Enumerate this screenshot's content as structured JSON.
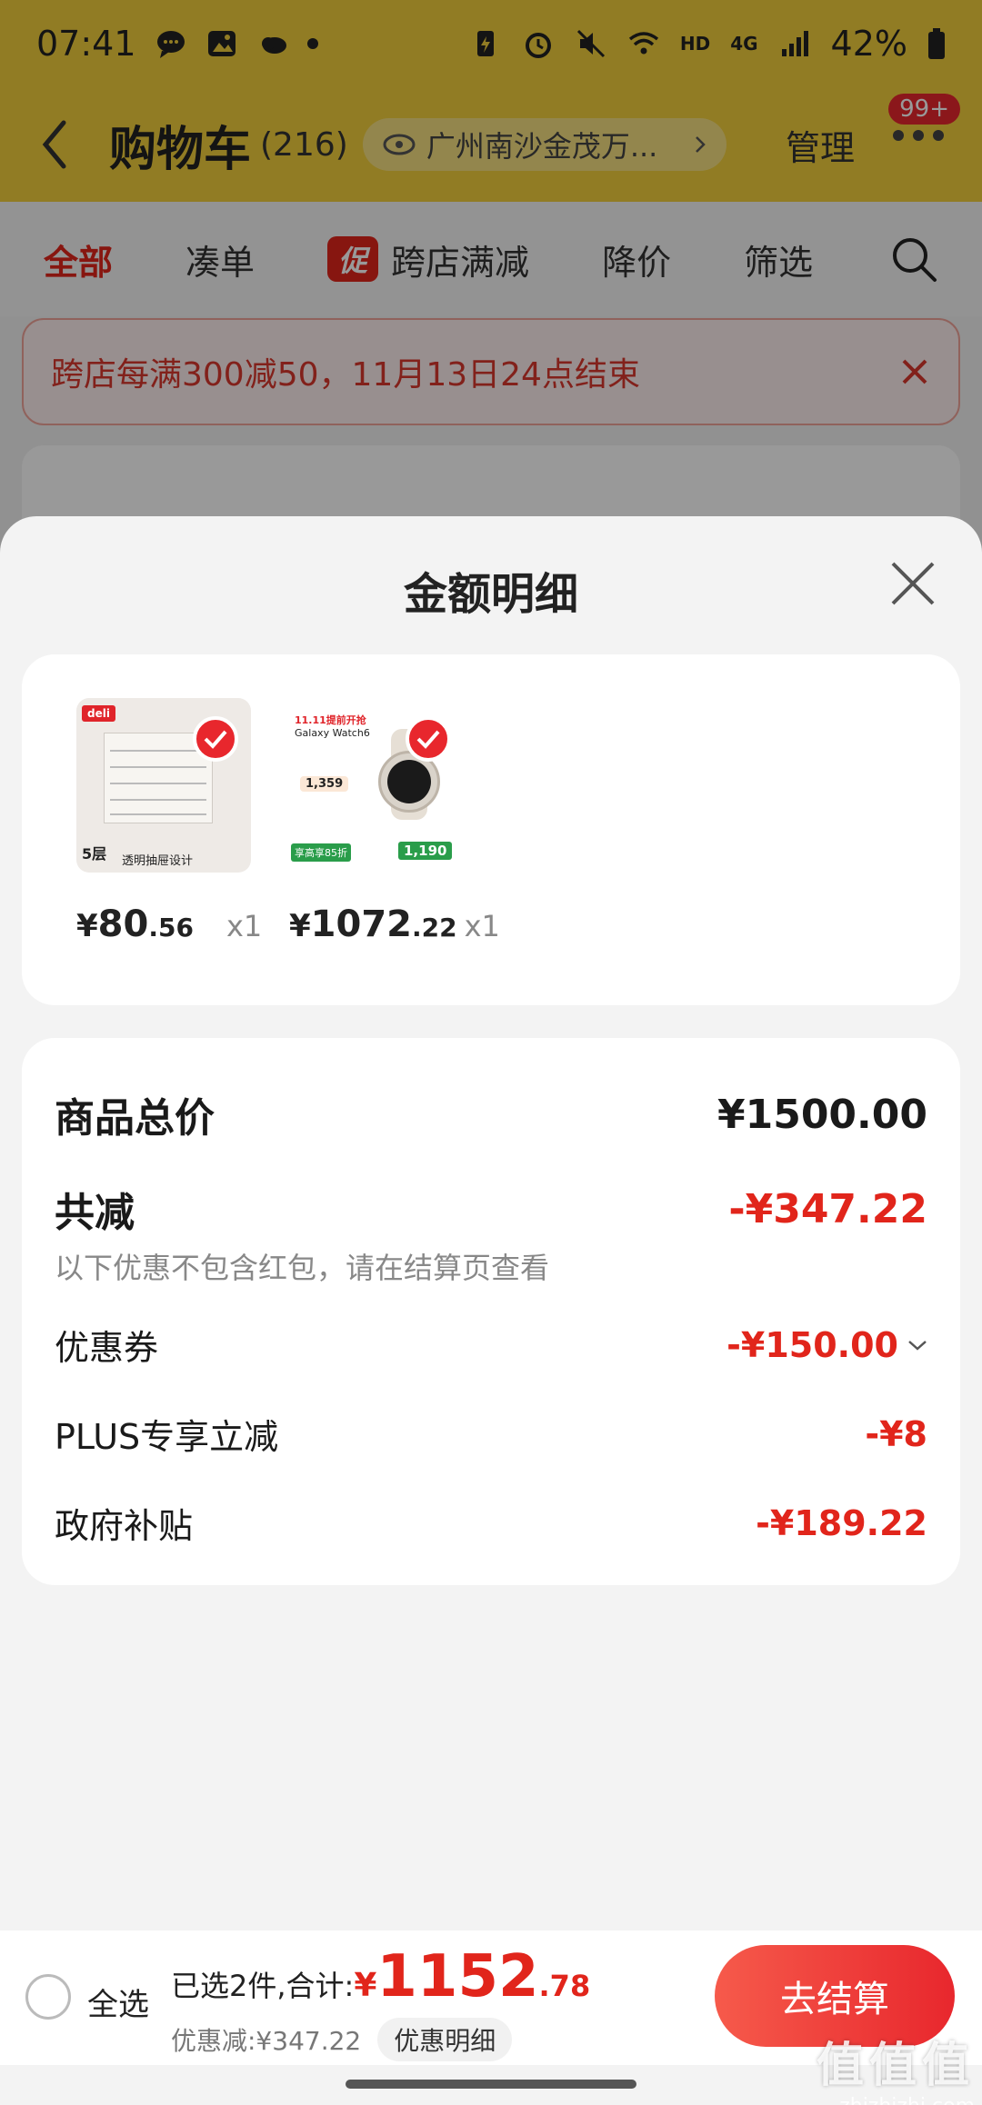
{
  "status_bar": {
    "time": "07:41",
    "network": "4G",
    "hd": "HD",
    "battery": "42%"
  },
  "nav": {
    "title": "购物车",
    "count": "(216)",
    "location": "广州南沙金茂万...",
    "manage": "管理",
    "badge": "99+"
  },
  "tabs": {
    "all": "全部",
    "bundle": "凑单",
    "promo_icon": "促",
    "cross_store": "跨店满减",
    "price_drop": "降价",
    "filter": "筛选"
  },
  "notice": {
    "text": "跨店每满300减50，11月13日24点结束"
  },
  "sheet": {
    "title": "金额明细",
    "items": [
      {
        "thumb_brand": "deli",
        "thumb_layers": "5层",
        "thumb_caption": "透明抽屉设计",
        "price_symbol": "¥",
        "price_int": "80",
        "price_dec": ".56",
        "qty": "x1"
      },
      {
        "thumb_promo": "11.11提前开抢",
        "thumb_name": "Galaxy Watch6",
        "thumb_price": "1,359",
        "thumb_discount": "享高享85折",
        "thumb_final": "1,190",
        "price_symbol": "¥",
        "price_int": "1072",
        "price_dec": ".22",
        "qty": "x1"
      }
    ],
    "details": {
      "total_label": "商品总价",
      "total_value": "¥1500.00",
      "reduced_label": "共减",
      "reduced_value": "-¥347.22",
      "reduced_note": "以下优惠不包含红包，请在结算页查看",
      "coupon_label": "优惠券",
      "coupon_value": "-¥150.00",
      "plus_label": "PLUS专享立减",
      "plus_value": "-¥8",
      "gov_label": "政府补贴",
      "gov_value": "-¥189.22"
    }
  },
  "checkout": {
    "select_all": "全选",
    "selected_label": "已选2件,合计:",
    "total_symbol": "¥",
    "total_int": "1152",
    "total_dec": ".78",
    "discount_text": "优惠减:¥347.22",
    "detail_button": "优惠明细",
    "checkout_button": "去结算"
  },
  "watermark": {
    "big": "值值值",
    "small": "zhizhizhi.com"
  },
  "colors": {
    "accent_red": "#e1251b",
    "nav_yellow": "#f2cf3c"
  }
}
